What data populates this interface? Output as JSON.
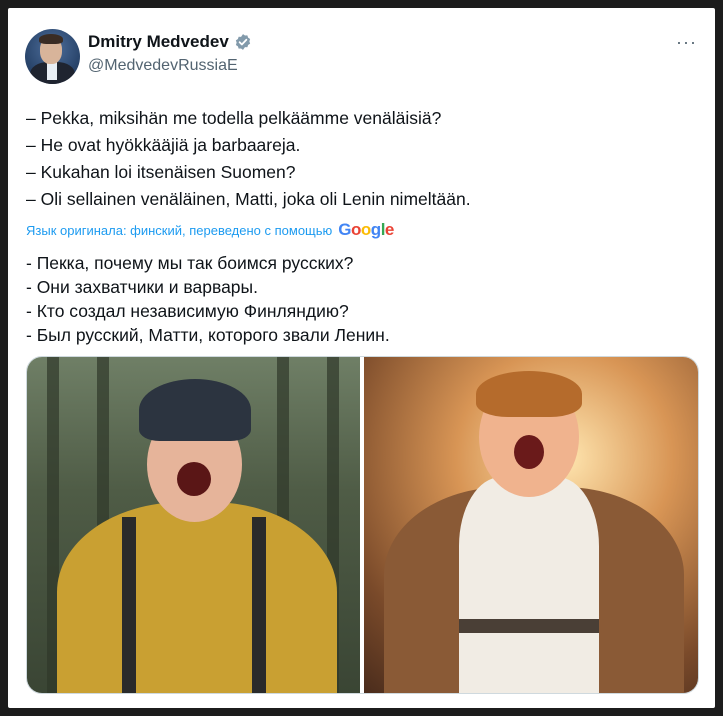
{
  "tweet": {
    "author_name": "Dmitry Medvedev",
    "author_handle": "@MedvedevRussiaE",
    "more_label": "···",
    "original_lines": [
      "– Pekka, miksihän me  todella pelkäämme venäläisiä?",
      "– He ovat hyökkääjiä ja barbaareja.",
      "– Kukahan loi itsenäisen Suomen?",
      "– Oli sellainen venäläinen, Matti, joka oli Lenin nimeltään."
    ],
    "translation_note": "Язык оригинала: финский, переведено с помощью",
    "translation_brand": "Google",
    "translated_lines": [
      "- Пекка, почему мы так боимся русских?",
      "- Они захватчики и варвары.",
      "- Кто создал независимую Финляндию?",
      "- Был русский, Матти, которого звали Ленин."
    ],
    "icons": {
      "verified": "verified-badge-icon",
      "more": "more-options-icon"
    },
    "colors": {
      "text": "#0f1419",
      "secondary": "#536471",
      "link": "#1d9bf0",
      "verified_badge": "#829aab"
    }
  }
}
